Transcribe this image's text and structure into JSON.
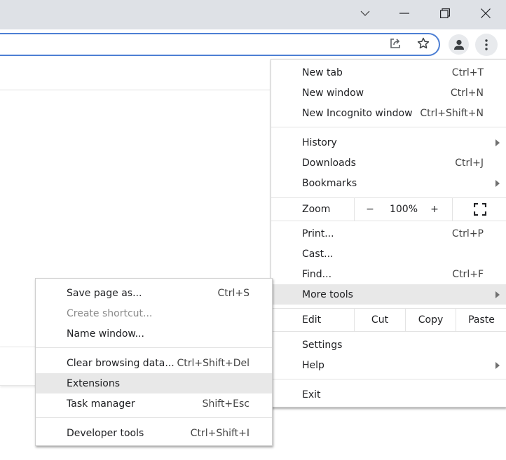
{
  "window": {
    "controls": {
      "tab_search": "chevron-down-icon",
      "minimize": "minimize-icon",
      "maximize": "restore-icon",
      "close": "close-icon"
    }
  },
  "toolbar": {
    "icons": [
      "share-icon",
      "star-icon",
      "profile-icon",
      "more-vert-icon"
    ]
  },
  "main_menu": {
    "group1": [
      {
        "label": "New tab",
        "shortcut": "Ctrl+T"
      },
      {
        "label": "New window",
        "shortcut": "Ctrl+N"
      },
      {
        "label": "New Incognito window",
        "shortcut": "Ctrl+Shift+N"
      }
    ],
    "group2": [
      {
        "label": "History",
        "submenu": true
      },
      {
        "label": "Downloads",
        "shortcut": "Ctrl+J"
      },
      {
        "label": "Bookmarks",
        "submenu": true
      }
    ],
    "zoom": {
      "label": "Zoom",
      "minus": "−",
      "value": "100%",
      "plus": "+"
    },
    "group3": [
      {
        "label": "Print...",
        "shortcut": "Ctrl+P"
      },
      {
        "label": "Cast..."
      },
      {
        "label": "Find...",
        "shortcut": "Ctrl+F"
      },
      {
        "label": "More tools",
        "submenu": true,
        "highlighted": true
      }
    ],
    "edit": {
      "label": "Edit",
      "cut": "Cut",
      "copy": "Copy",
      "paste": "Paste"
    },
    "group4": [
      {
        "label": "Settings"
      },
      {
        "label": "Help",
        "submenu": true
      }
    ],
    "group5": [
      {
        "label": "Exit"
      }
    ]
  },
  "more_tools_menu": {
    "group1": [
      {
        "label": "Save page as...",
        "shortcut": "Ctrl+S"
      },
      {
        "label": "Create shortcut...",
        "disabled": true
      },
      {
        "label": "Name window..."
      }
    ],
    "group2": [
      {
        "label": "Clear browsing data...",
        "shortcut": "Ctrl+Shift+Del"
      },
      {
        "label": "Extensions",
        "highlighted": true
      },
      {
        "label": "Task manager",
        "shortcut": "Shift+Esc"
      }
    ],
    "group3": [
      {
        "label": "Developer tools",
        "shortcut": "Ctrl+Shift+I"
      }
    ]
  }
}
